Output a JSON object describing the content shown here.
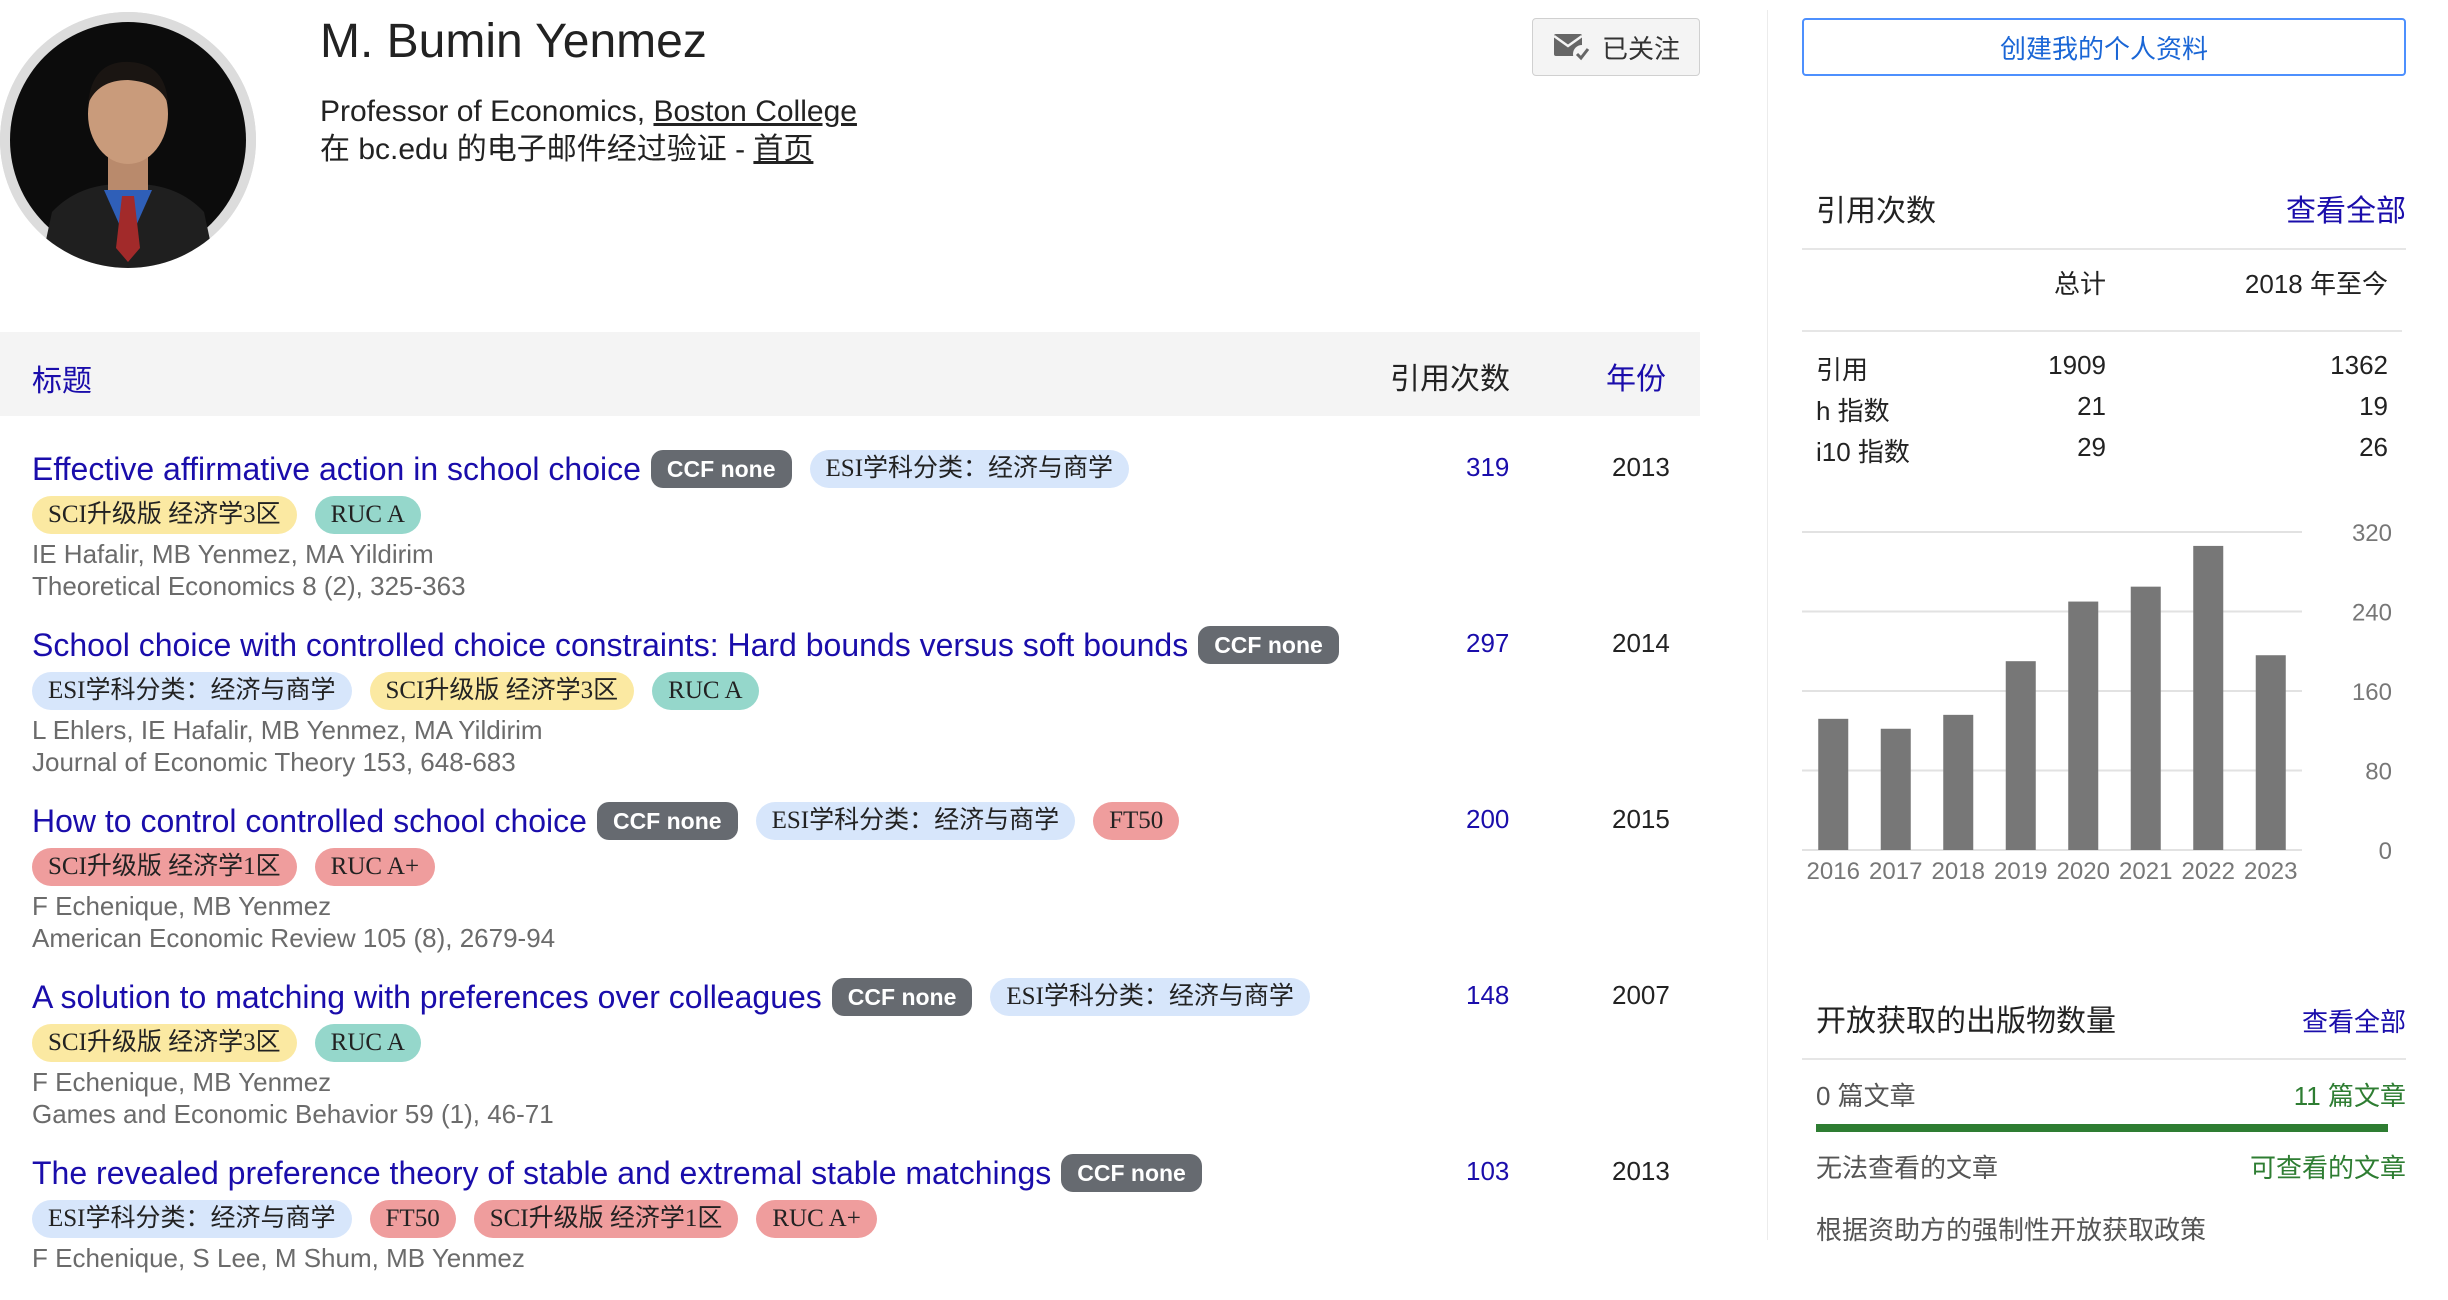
{
  "profile": {
    "name": "M. Bumin Yenmez",
    "affiliation_prefix": "Professor of Economics, ",
    "affiliation_link": "Boston College",
    "verified_prefix": "在 bc.edu 的电子邮件经过验证 - ",
    "homepage_link": "首页",
    "follow_label": "已关注"
  },
  "table": {
    "col_title": "标题",
    "col_cited": "引用次数",
    "col_year": "年份",
    "rows": [
      {
        "title": "Effective affirmative action in school choice",
        "tags": [
          {
            "label": "CCF none",
            "kind": "ccf"
          },
          {
            "label": "ESI学科分类：经济与商学",
            "kind": "esi"
          },
          {
            "label": "SCI升级版 经济学3区",
            "kind": "sci3"
          },
          {
            "label": "RUC A",
            "kind": "ruc"
          }
        ],
        "authors": "IE Hafalir, MB Yenmez, MA Yildirim",
        "venue": "Theoretical Economics 8 (2), 325-363",
        "cited": "319",
        "year": "2013"
      },
      {
        "title": "School choice with controlled choice constraints: Hard bounds versus soft bounds",
        "tags": [
          {
            "label": "CCF none",
            "kind": "ccf"
          },
          {
            "label": "ESI学科分类：经济与商学",
            "kind": "esi"
          },
          {
            "label": "SCI升级版 经济学3区",
            "kind": "sci3"
          },
          {
            "label": "RUC A",
            "kind": "ruc"
          }
        ],
        "authors": "L Ehlers, IE Hafalir, MB Yenmez, MA Yildirim",
        "venue": "Journal of Economic Theory 153, 648-683",
        "cited": "297",
        "year": "2014"
      },
      {
        "title": "How to control controlled school choice",
        "tags": [
          {
            "label": "CCF none",
            "kind": "ccf"
          },
          {
            "label": "ESI学科分类：经济与商学",
            "kind": "esi"
          },
          {
            "label": "FT50",
            "kind": "ft"
          },
          {
            "label": "SCI升级版 经济学1区",
            "kind": "sci1"
          },
          {
            "label": "RUC A+",
            "kind": "ruca"
          }
        ],
        "authors": "F Echenique, MB Yenmez",
        "venue": "American Economic Review 105 (8), 2679-94",
        "cited": "200",
        "year": "2015"
      },
      {
        "title": "A solution to matching with preferences over colleagues",
        "tags": [
          {
            "label": "CCF none",
            "kind": "ccf"
          },
          {
            "label": "ESI学科分类：经济与商学",
            "kind": "esi"
          },
          {
            "label": "SCI升级版 经济学3区",
            "kind": "sci3"
          },
          {
            "label": "RUC A",
            "kind": "ruc"
          }
        ],
        "authors": "F Echenique, MB Yenmez",
        "venue": "Games and Economic Behavior 59 (1), 46-71",
        "cited": "148",
        "year": "2007"
      },
      {
        "title": "The revealed preference theory of stable and extremal stable matchings",
        "tags": [
          {
            "label": "CCF none",
            "kind": "ccf"
          },
          {
            "label": "ESI学科分类：经济与商学",
            "kind": "esi"
          },
          {
            "label": "FT50",
            "kind": "ft"
          },
          {
            "label": "SCI升级版 经济学1区",
            "kind": "sci1"
          },
          {
            "label": "RUC A+",
            "kind": "ruca"
          }
        ],
        "authors": "F Echenique, S Lee, M Shum, MB Yenmez",
        "venue": "",
        "cited": "103",
        "year": "2013"
      }
    ]
  },
  "sidebar": {
    "create_profile": "创建我的个人资料",
    "citations": {
      "heading": "引用次数",
      "view_all": "查看全部",
      "col_total": "总计",
      "col_since": "2018 年至今",
      "rows": [
        {
          "label": "引用",
          "total": "1909",
          "since": "1362"
        },
        {
          "label": "h 指数",
          "total": "21",
          "since": "19"
        },
        {
          "label": "i10 指数",
          "total": "29",
          "since": "26"
        }
      ]
    },
    "open_access": {
      "heading": "开放获取的出版物数量",
      "view_all": "查看全部",
      "left_count": "0 篇文章",
      "right_count": "11 篇文章",
      "left_label": "无法查看的文章",
      "right_label": "可查看的文章",
      "mandate_text": "根据资助方的强制性开放获取政策"
    }
  },
  "colors": {
    "link": "#1a0dab",
    "bar": "#777777",
    "open_access_green": "#2e7d32"
  },
  "chart_data": {
    "type": "bar",
    "categories": [
      "2016",
      "2017",
      "2018",
      "2019",
      "2020",
      "2021",
      "2022",
      "2023"
    ],
    "values": [
      132,
      122,
      136,
      190,
      250,
      265,
      306,
      196
    ],
    "ylim": [
      0,
      320
    ],
    "yticks": [
      0,
      80,
      160,
      240,
      320
    ],
    "grid": true,
    "title": "",
    "xlabel": "",
    "ylabel": ""
  }
}
